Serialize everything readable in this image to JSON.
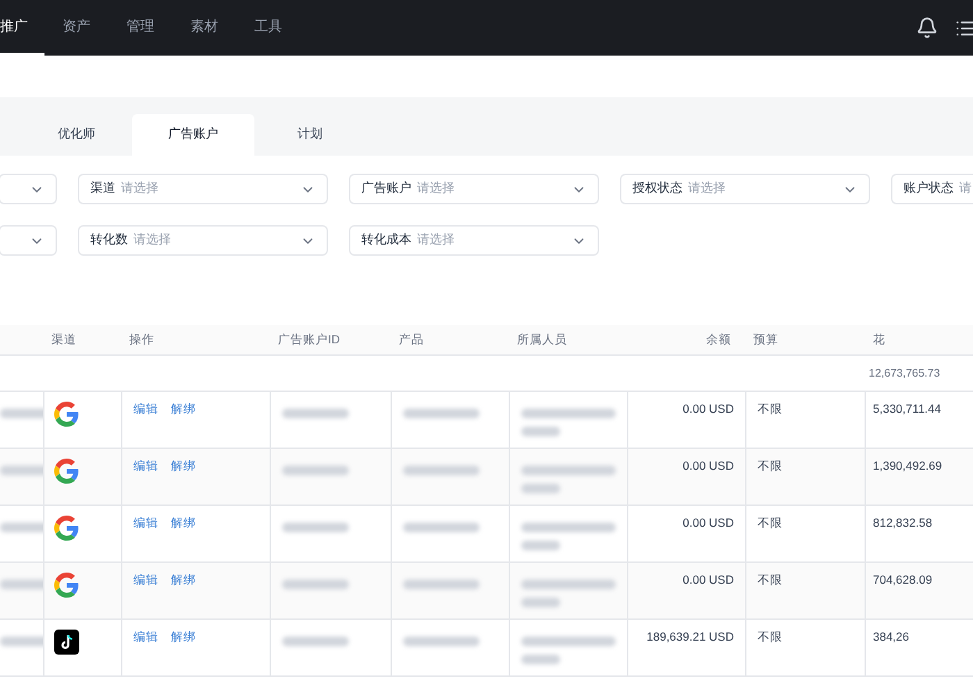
{
  "nav": {
    "items": [
      {
        "label": "推广",
        "selected": true
      },
      {
        "label": "资产",
        "selected": false
      },
      {
        "label": "管理",
        "selected": false
      },
      {
        "label": "素材",
        "selected": false
      },
      {
        "label": "工具",
        "selected": false
      }
    ]
  },
  "tabs": [
    {
      "label": "优化师",
      "selected": false
    },
    {
      "label": "广告账户",
      "selected": true
    },
    {
      "label": "计划",
      "selected": false
    }
  ],
  "filters": [
    [
      {
        "label": "渠道",
        "placeholder": "请选择"
      },
      {
        "label": "广告账户",
        "placeholder": "请选择"
      },
      {
        "label": "授权状态",
        "placeholder": "请选择"
      },
      {
        "label": "账户状态",
        "placeholder": "请"
      }
    ],
    [
      {
        "label": "转化数",
        "placeholder": "请选择"
      },
      {
        "label": "转化成本",
        "placeholder": "请选择"
      }
    ]
  ],
  "table": {
    "columns": [
      "渠道",
      "操作",
      "广告账户ID",
      "产品",
      "所属人员",
      "余额",
      "预算",
      "花"
    ],
    "total": "12,673,765.73",
    "rows": [
      {
        "kind": "google",
        "actions": [
          "编辑",
          "解绑"
        ],
        "balance": "0.00 USD",
        "budget": "不限",
        "spend": "5,330,711.44"
      },
      {
        "kind": "google",
        "actions": [
          "编辑",
          "解绑"
        ],
        "balance": "0.00 USD",
        "budget": "不限",
        "spend": "1,390,492.69"
      },
      {
        "kind": "google",
        "actions": [
          "编辑",
          "解绑"
        ],
        "balance": "0.00 USD",
        "budget": "不限",
        "spend": "812,832.58"
      },
      {
        "kind": "google",
        "actions": [
          "编辑",
          "解绑"
        ],
        "balance": "0.00 USD",
        "budget": "不限",
        "spend": "704,628.09"
      },
      {
        "kind": "tiktok",
        "actions": [
          "编辑",
          "解绑"
        ],
        "balance": "189,639.21 USD",
        "budget": "不限",
        "spend": "384,26"
      }
    ]
  }
}
